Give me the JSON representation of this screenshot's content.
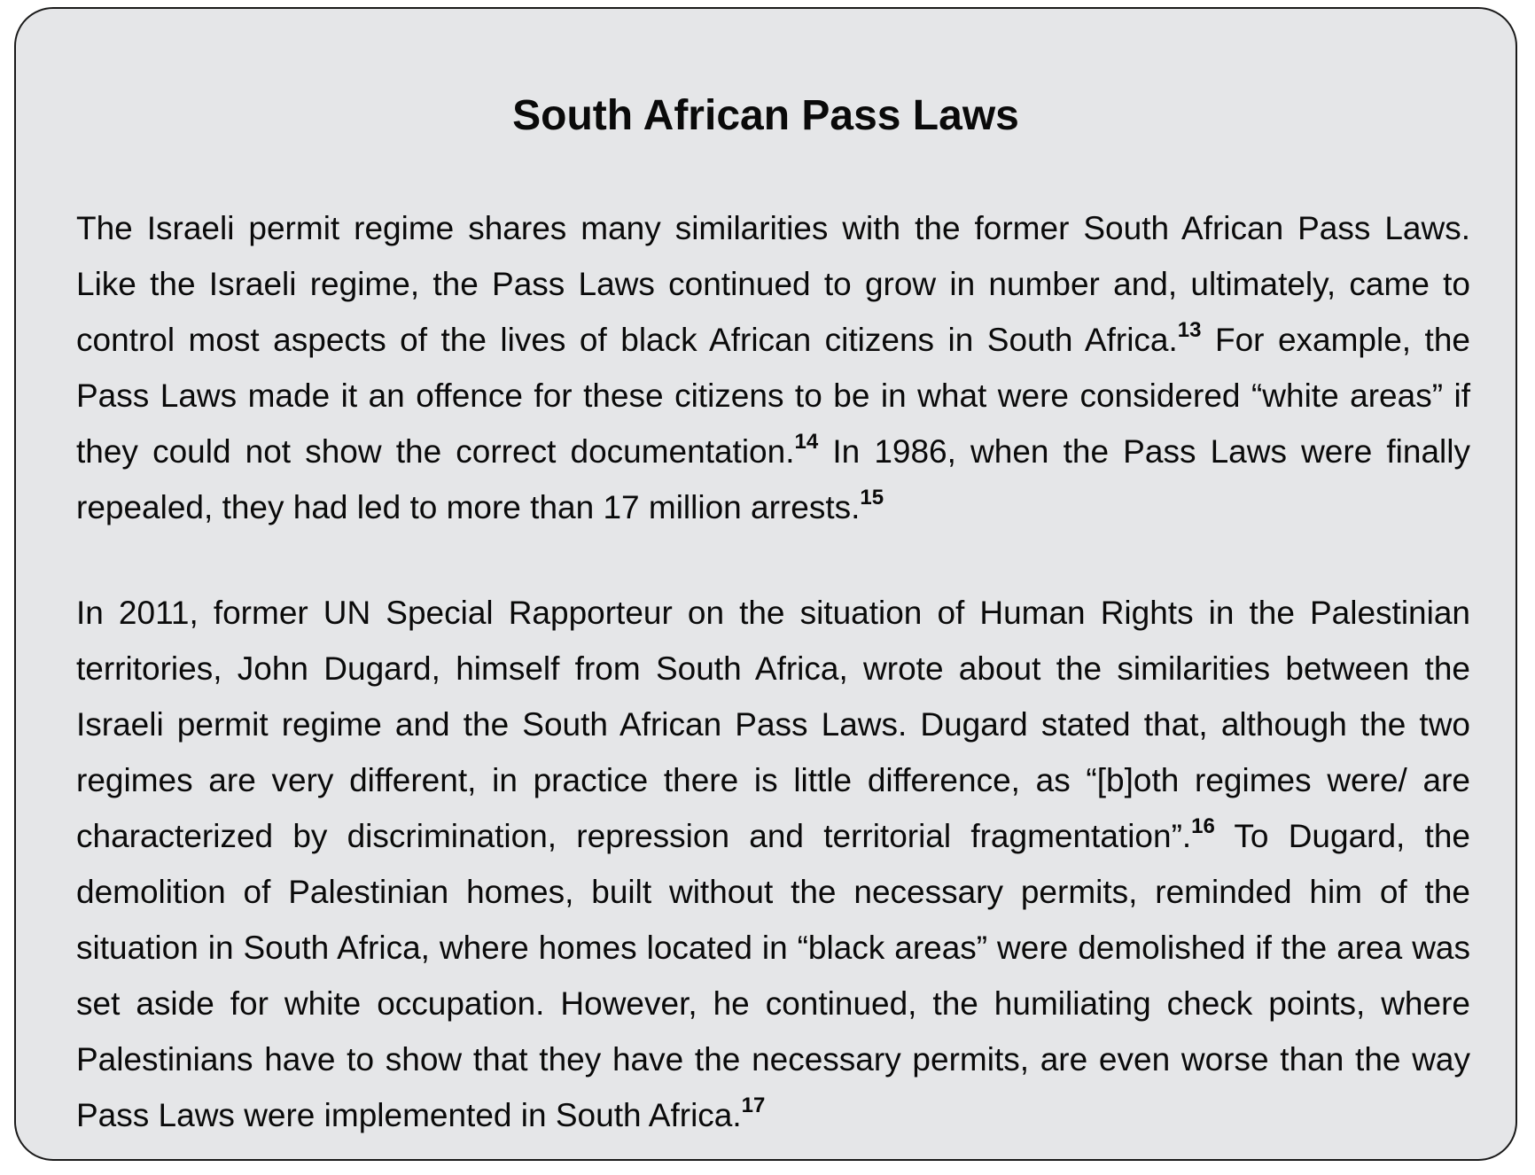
{
  "title": "South African Pass Laws",
  "paragraph1": {
    "text_a": "The Israeli permit regime shares many similarities with the former South African Pass Laws. Like the Israeli regime, the Pass Laws continued to grow in number and, ultimately, came to control most aspects of the lives of black African citizens in South Africa.",
    "fn_13": "13",
    "text_b": " For example, the Pass Laws made it an offence for these citizens to be in what were considered “white areas” if they could not show the correct documentation.",
    "fn_14": "14",
    "text_c": " In 1986, when the Pass Laws were finally repealed, they had led to more than 17 million arrests.",
    "fn_15": "15"
  },
  "paragraph2": {
    "text_a": "In 2011, former UN Special Rapporteur on the situation of Human Rights in the Palestinian territories, John Dugard, himself from South Africa, wrote about the similarities between the Israeli permit regime and the South African Pass Laws. Dugard stated that, although the two regimes are very different, in practice there is little difference, as “[b]oth regimes were/ are characterized by discrimination, repression and territorial fragmentation”.",
    "fn_16": "16",
    "text_b": " To Dugard, the demolition of Palestinian homes, built without the necessary permits, reminded him of the situation in South Africa, where homes located in “black areas” were demolished if the area was set aside for white occupation. However, he continued, the humiliating check points, where Palestinians have to show that they have the necessary permits, are even worse than the way Pass Laws were implemented in South Africa.",
    "fn_17": "17"
  }
}
